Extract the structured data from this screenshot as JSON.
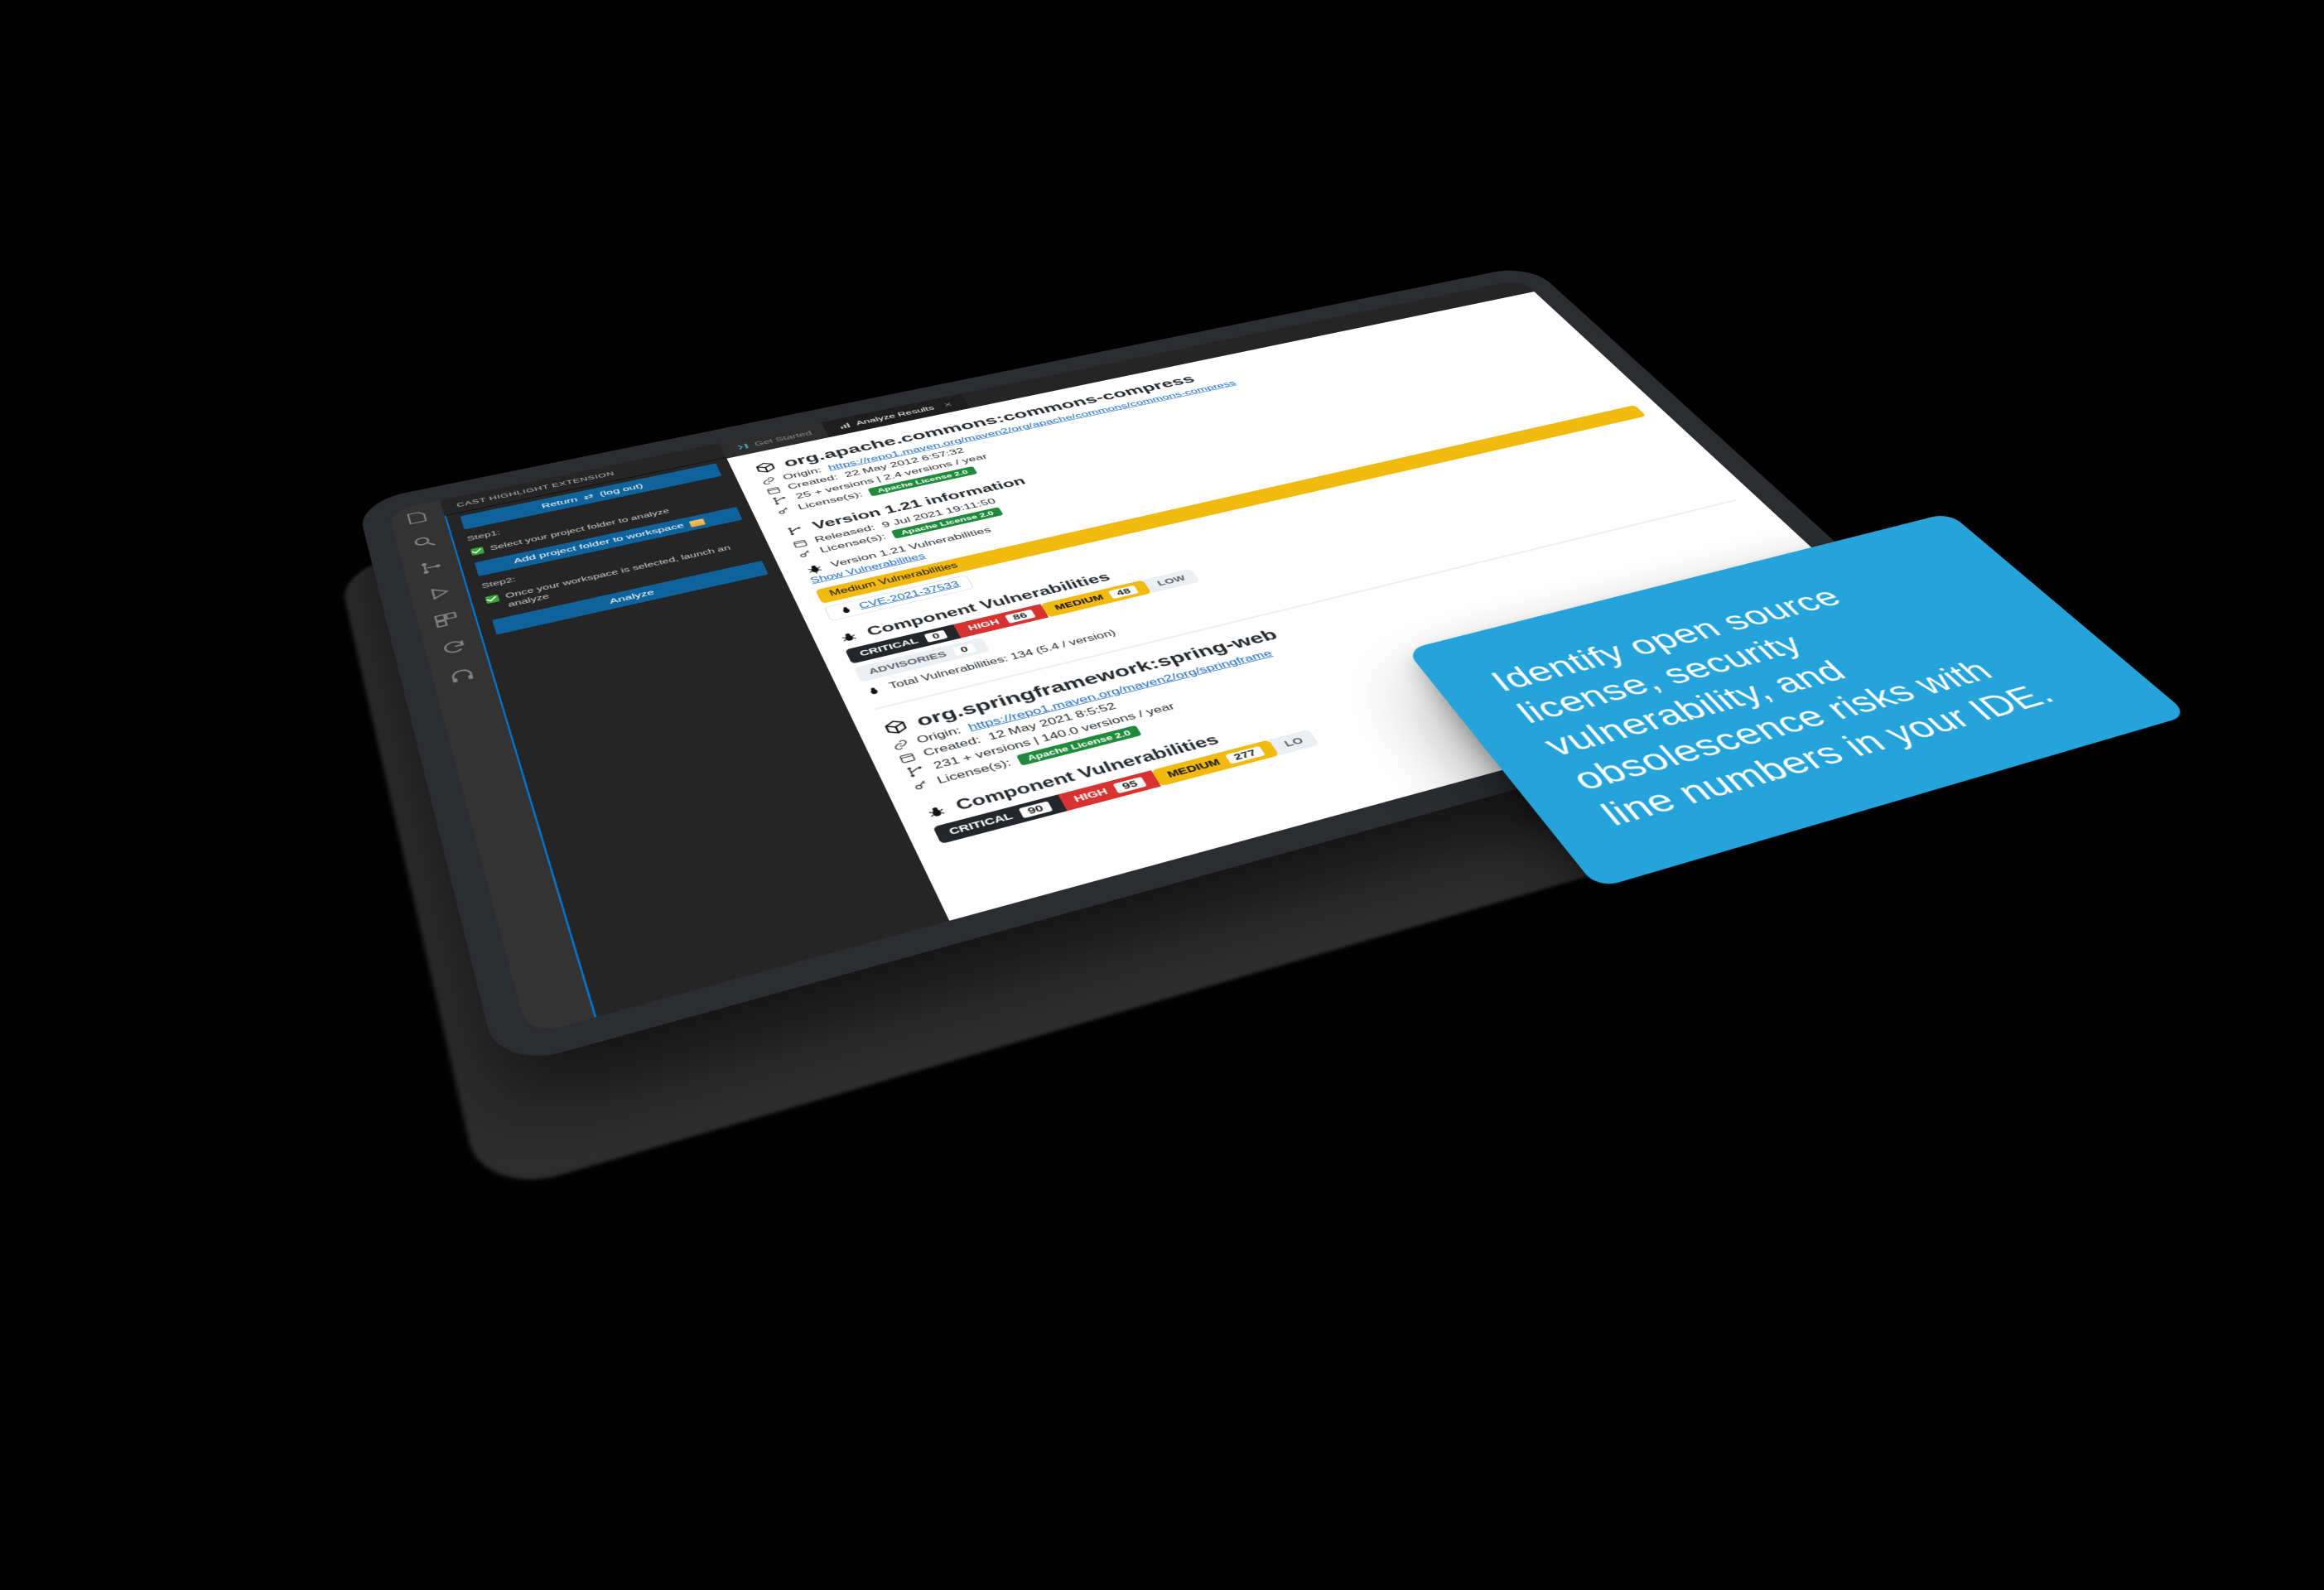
{
  "side": {
    "title": "CAST HIGHLIGHT EXTENSION",
    "return_label": "Return",
    "logout_label": "(log out)",
    "step1_label": "Step1:",
    "step1_text": "Select your project folder to analyze",
    "add_folder_button": "Add project folder to workspace",
    "step2_label": "Step2:",
    "step2_text": "Once your workspace is selected, launch an analyze",
    "analyze_button": "Analyze"
  },
  "tabs": {
    "get_started": "Get Started",
    "analyze_results": "Analyze Results"
  },
  "pkg1": {
    "title": "org.apache.commons:commons-compress",
    "origin_label": "Origin:",
    "origin_url": "https://repo1.maven.org/maven2/org/apache/commons/commons-compress",
    "created_label": "Created:",
    "created_value": "22 May 2012 6:57:32",
    "versions_info": "25 + versions | 2.4 versions / year",
    "license_label": "License(s):",
    "license_value": "Apache License 2.0",
    "ver_title": "Version 1.21 information",
    "released_label": "Released:",
    "released_value": "9 Jul 2021 19:11:50",
    "ver_vuln_title": "Version 1.21 Vulnerabilities",
    "show_vuln_link": "Show Vulnerabilities",
    "medium_badge": "Medium Vulnerabilities",
    "cve": "CVE-2021-37533",
    "comp_vuln_title": "Component Vulnerabilities",
    "critical": "CRITICAL",
    "critical_n": "0",
    "high": "HIGH",
    "high_n": "86",
    "medium": "MEDIUM",
    "medium_n": "48",
    "low": "LOW",
    "advisories": "ADVISORIES",
    "advisories_n": "0",
    "total_line": "Total Vulnerabilities: 134 (5.4 / version)"
  },
  "pkg2": {
    "title": "org.springframework:spring-web",
    "origin_label": "Origin:",
    "origin_url": "https://repo1.maven.org/maven2/org/springframe",
    "created_label": "Created:",
    "created_value": "12 May 2021 8:5:52",
    "versions_info": "231 + versions | 140.0 versions / year",
    "license_label": "License(s):",
    "license_value": "Apache License 2.0",
    "comp_vuln_title": "Component Vulnerabilities",
    "critical": "CRITICAL",
    "critical_n": "90",
    "high": "HIGH",
    "high_n": "95",
    "medium": "MEDIUM",
    "medium_n": "277",
    "low": "LO"
  },
  "callout": {
    "text": "Identify open source license, security vulnerability, and obsolescence risks with line numbers in your IDE."
  }
}
